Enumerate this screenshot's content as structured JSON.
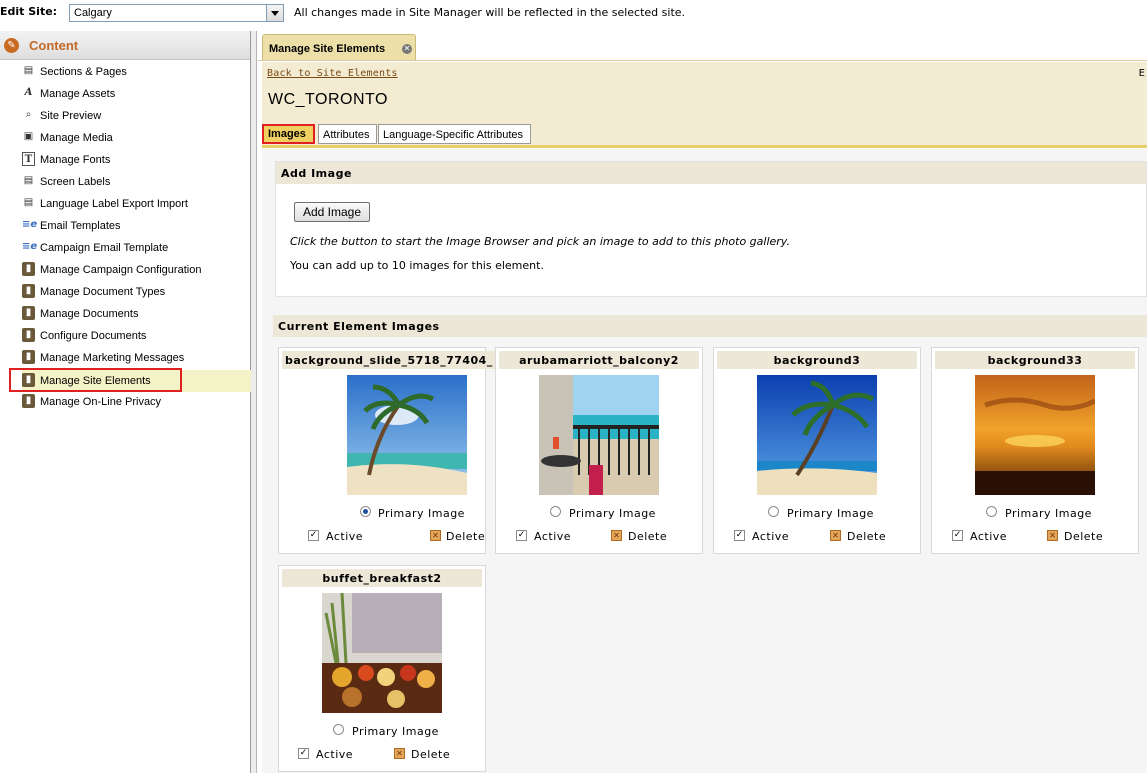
{
  "topbar": {
    "edit_site_label": "Edit Site:",
    "site_value": "Calgary",
    "message": "All changes made in Site Manager will be reflected in the selected site."
  },
  "sidebar": {
    "title": "Content",
    "items": [
      {
        "label": "Sections & Pages",
        "icon": "page-icon"
      },
      {
        "label": "Manage Assets",
        "icon": "font-a-icon"
      },
      {
        "label": "Site Preview",
        "icon": "magnifier-icon"
      },
      {
        "label": "Manage Media",
        "icon": "media-icon"
      },
      {
        "label": "Manage Fonts",
        "icon": "font-t-icon"
      },
      {
        "label": "Screen Labels",
        "icon": "page-icon"
      },
      {
        "label": "Language Label Export Import",
        "icon": "page-icon"
      },
      {
        "label": "Email Templates",
        "icon": "email-icon"
      },
      {
        "label": "Campaign Email Template",
        "icon": "email-icon"
      },
      {
        "label": "Manage Campaign Configuration",
        "icon": "document-icon"
      },
      {
        "label": "Manage Document Types",
        "icon": "document-icon"
      },
      {
        "label": "Manage Documents",
        "icon": "document-icon"
      },
      {
        "label": "Configure Documents",
        "icon": "document-icon"
      },
      {
        "label": "Manage Marketing Messages",
        "icon": "document-icon"
      },
      {
        "label": "Manage Site Elements",
        "icon": "document-icon"
      },
      {
        "label": "Manage On-Line Privacy",
        "icon": "document-icon"
      }
    ],
    "selected_index": 14
  },
  "main": {
    "tab_label": "Manage Site Elements",
    "back_link": "Back to Site Elements",
    "right_text": "E",
    "element_title": "WC_TORONTO",
    "subtabs": [
      "Images",
      "Attributes",
      "Language-Specific Attributes"
    ],
    "active_subtab": "Images",
    "add_section": {
      "header": "Add Image",
      "button": "Add Image",
      "hint": "Click the button to start the Image Browser and pick an image to add to this photo gallery.",
      "limit": "You can add up to 10 images for this element."
    },
    "current_section": {
      "header": "Current Element Images",
      "primary_label": "Primary Image",
      "active_label": "Active",
      "delete_label": "Delete",
      "images": [
        {
          "name": "background_slide_5718_77404_",
          "primary": true,
          "active": true,
          "scene": "beach-palm-icon"
        },
        {
          "name": "arubamarriott_balcony2",
          "primary": false,
          "active": true,
          "scene": "balcony-icon"
        },
        {
          "name": "background3",
          "primary": false,
          "active": true,
          "scene": "beach-palm-icon"
        },
        {
          "name": "background33",
          "primary": false,
          "active": true,
          "scene": "sunset-icon"
        },
        {
          "name": "buffet_breakfast2",
          "primary": false,
          "active": true,
          "scene": "buffet-icon"
        }
      ]
    }
  },
  "colors": {
    "accent_orange": "#c46a29",
    "tab_gold": "#ecdfa8",
    "highlight_red": "#e02020"
  }
}
